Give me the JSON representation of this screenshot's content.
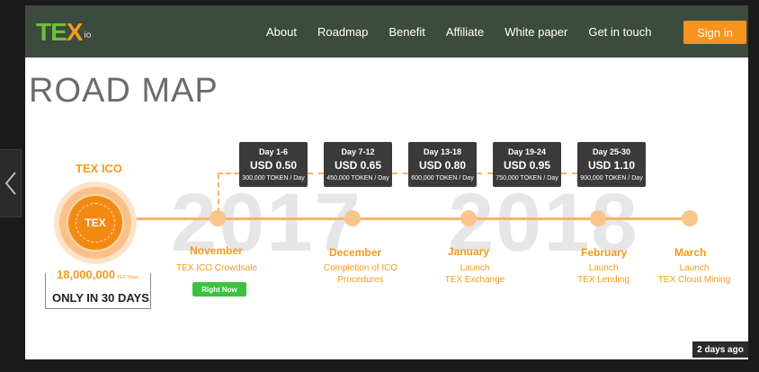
{
  "navbar": {
    "logo": {
      "main": "TEX",
      "suffix": "io"
    },
    "links": [
      "About",
      "Roadmap",
      "Benefit",
      "Affiliate",
      "White paper",
      "Get in touch"
    ],
    "signin_label": "Sign in"
  },
  "content": {
    "title": "ROAD MAP",
    "years": [
      "2017",
      "2018"
    ],
    "ico": {
      "title": "TEX ICO",
      "badge": "TEX",
      "supply": "18,000,000",
      "supply_unit": "TEX Token",
      "duration": "ONLY IN 30 DAYS"
    },
    "price_boxes": [
      {
        "days": "Day 1-6",
        "price": "USD 0.50",
        "tokens": "300,000 TOKEN / Day"
      },
      {
        "days": "Day 7-12",
        "price": "USD 0.65",
        "tokens": "450,000 TOKEN / Day"
      },
      {
        "days": "Day 13-18",
        "price": "USD 0.80",
        "tokens": "600,000 TOKEN / Day"
      },
      {
        "days": "Day 19-24",
        "price": "USD 0.95",
        "tokens": "750,000 TOKEN / Day"
      },
      {
        "days": "Day 25-30",
        "price": "USD 1.10",
        "tokens": "900,000 TOKEN / Day"
      }
    ],
    "milestones": [
      {
        "month": "November",
        "line1": "TEX ICO Crowdsale",
        "line2": ""
      },
      {
        "month": "December",
        "line1": "Completion of ICO",
        "line2": "Procedures"
      },
      {
        "month": "January",
        "line1": "Launch",
        "line2": "TEX Exchange"
      },
      {
        "month": "February",
        "line1": "Launch",
        "line2": "TEX Lending"
      },
      {
        "month": "March",
        "line1": "Launch",
        "line2": "TEX Cloud Mining"
      }
    ],
    "right_now_label": "Right Now"
  },
  "viewer": {
    "timestamp": "2 days ago"
  },
  "icons": {
    "prev": "chevron-left-icon"
  },
  "colors": {
    "accent": "#f7931e",
    "green": "#6ec13a",
    "navbar": "#3d4a3e"
  }
}
